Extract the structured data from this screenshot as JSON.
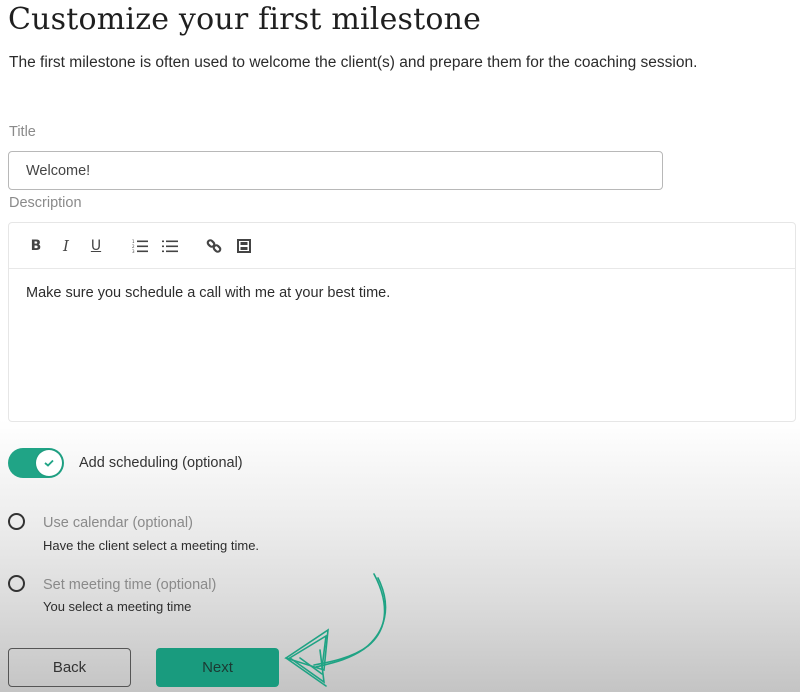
{
  "header": {
    "title": "Customize your first milestone",
    "subtitle": "The first milestone is often used to welcome the client(s) and prepare them for the coaching session."
  },
  "form": {
    "title_label": "Title",
    "title_value": "Welcome!",
    "description_label": "Description",
    "toolbar": [
      {
        "icon": "bold-icon",
        "glyph": "B"
      },
      {
        "icon": "italic-icon",
        "glyph": "I"
      },
      {
        "icon": "underline-icon",
        "glyph": "U"
      },
      {
        "icon": "ordered-list-icon",
        "glyph": "ol"
      },
      {
        "icon": "bullet-list-icon",
        "glyph": "ul"
      },
      {
        "icon": "link-icon",
        "glyph": "link"
      },
      {
        "icon": "video-icon",
        "glyph": "film"
      }
    ],
    "description_value": "Make sure you schedule a call with me at your best time."
  },
  "scheduling": {
    "toggle_label": "Add scheduling (optional)",
    "toggle_on": true,
    "options": [
      {
        "title": "Use calendar (optional)",
        "description": "Have the client select a meeting time.",
        "selected": false
      },
      {
        "title": "Set meeting time (optional)",
        "description": "You select a meeting time",
        "selected": false
      }
    ]
  },
  "actions": {
    "back_label": "Back",
    "next_label": "Next"
  },
  "colors": {
    "accent": "#20a486",
    "button_primary": "#199b7e",
    "annotation_arrow": "#1fa384"
  }
}
